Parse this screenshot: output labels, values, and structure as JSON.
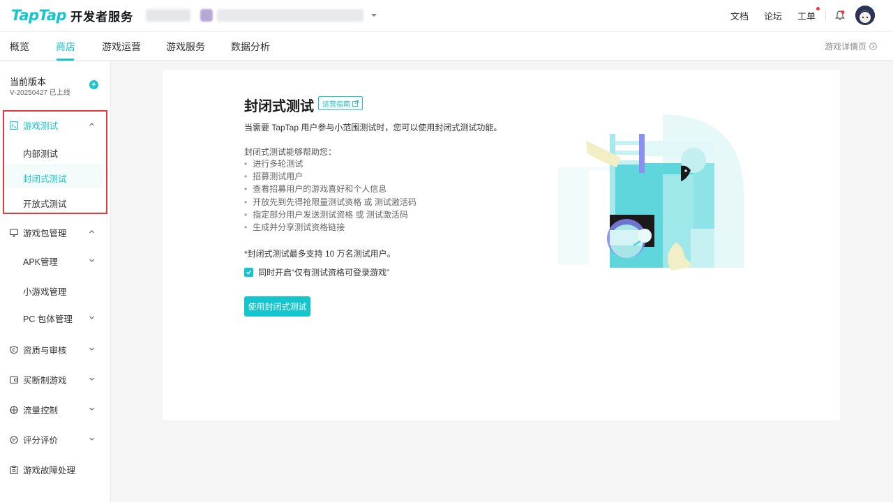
{
  "header": {
    "logo_brand": "TapTap",
    "logo_suffix": "开发者服务",
    "links": [
      {
        "label": "文档"
      },
      {
        "label": "论坛"
      },
      {
        "label": "工单"
      }
    ]
  },
  "subnav": {
    "tabs": [
      {
        "label": "概览"
      },
      {
        "label": "商店"
      },
      {
        "label": "游戏运营"
      },
      {
        "label": "游戏服务"
      },
      {
        "label": "数据分析"
      }
    ],
    "active_tab": "商店",
    "game_detail_label": "游戏详情页"
  },
  "sidebar": {
    "version_title": "当前版本",
    "version_sub": "V-20250427 已上线",
    "groups": [
      {
        "label": "游戏测试",
        "items": [
          {
            "label": "内部测试"
          },
          {
            "label": "封闭式测试"
          },
          {
            "label": "开放式测试"
          }
        ]
      },
      {
        "label": "游戏包管理",
        "items": [
          {
            "label": "APK管理"
          },
          {
            "label": "小游戏管理"
          },
          {
            "label": "PC 包体管理"
          }
        ]
      },
      {
        "label": "资质与审核"
      },
      {
        "label": "买断制游戏"
      },
      {
        "label": "流量控制"
      },
      {
        "label": "评分评价"
      },
      {
        "label": "游戏故障处理"
      }
    ],
    "active_item": "封闭式测试"
  },
  "main": {
    "title": "封闭式测试",
    "guide_label": "运营指南",
    "description": "当需要 TapTap 用户参与小范围测试时，您可以使用封闭式测试功能。",
    "help_title": "封闭式测试能够帮助您：",
    "bullets": [
      "进行多轮测试",
      "招募测试用户",
      "查看招募用户的游戏喜好和个人信息",
      "开放先到先得抢限量测试资格 或 测试激活码",
      "指定部分用户发送测试资格 或 测试激活码",
      "生成并分享测试资格链接"
    ],
    "note": "*封闭式测试最多支持 10 万名测试用户。",
    "checkbox_label": "同时开启“仅有测试资格可登录游戏”",
    "checkbox_checked": true,
    "cta_label": "使用封闭式测试"
  },
  "colors": {
    "accent": "#15c5ce",
    "highlight_box": "#e5393d",
    "notification_dot": "#f03b3b"
  }
}
